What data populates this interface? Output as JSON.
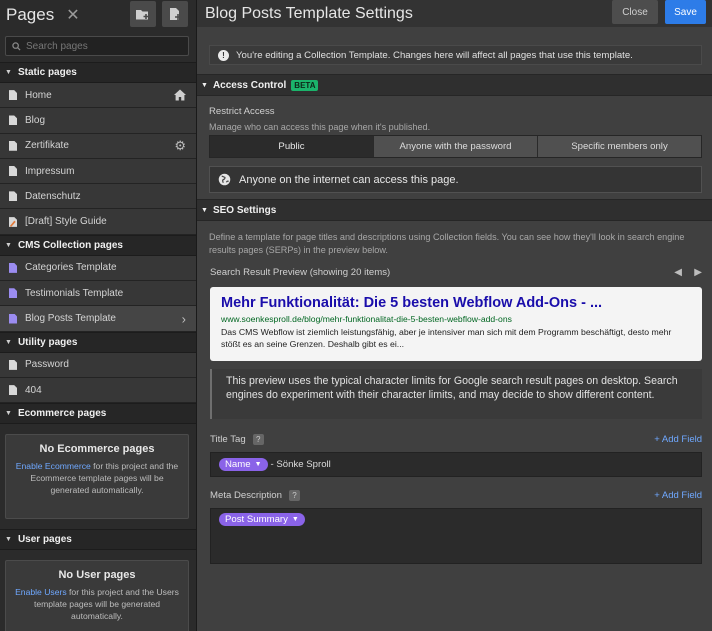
{
  "sidebar": {
    "title": "Pages",
    "search_placeholder": "Search pages",
    "sections": [
      {
        "title": "Static pages",
        "items": [
          {
            "label": "Home",
            "right_icon": "home-icon"
          },
          {
            "label": "Blog"
          },
          {
            "label": "Zertifikate",
            "right_icon": "gear-icon"
          },
          {
            "label": "Impressum"
          },
          {
            "label": "Datenschutz"
          },
          {
            "label": "[Draft] Style Guide"
          }
        ]
      },
      {
        "title": "CMS Collection pages",
        "items": [
          {
            "label": "Categories Template"
          },
          {
            "label": "Testimonials Template"
          },
          {
            "label": "Blog Posts Template",
            "right_icon": "chevron-right-icon"
          }
        ]
      },
      {
        "title": "Utility pages",
        "items": [
          {
            "label": "Password"
          },
          {
            "label": "404"
          }
        ]
      },
      {
        "title": "Ecommerce pages"
      },
      {
        "title": "User pages"
      }
    ],
    "ecommerce_empty": {
      "title": "No Ecommerce pages",
      "link": "Enable Ecommerce",
      "text": "for this project and the Ecommerce template pages will be generated automatically."
    },
    "users_empty": {
      "title": "No User pages",
      "link": "Enable Users",
      "text": "for this project and the Users template pages will be generated automatically."
    }
  },
  "header": {
    "title": "Blog Posts Template Settings",
    "close_label": "Close",
    "save_label": "Save"
  },
  "notice": "You're editing a Collection Template. Changes here will affect all pages that use this template.",
  "access": {
    "title": "Access Control",
    "badge": "BETA",
    "restrict_label": "Restrict Access",
    "restrict_desc": "Manage who can access this page when it's published.",
    "options": [
      "Public",
      "Anyone with the password",
      "Specific members only"
    ],
    "selected": "Public",
    "info": "Anyone on the internet can access this page."
  },
  "seo": {
    "title": "SEO Settings",
    "description": "Define a template for page titles and descriptions using Collection fields. You can see how they'll look in search engine results pages (SERPs) in the preview below.",
    "preview_label": "Search Result Preview (showing 20 items)",
    "serp": {
      "title": "Mehr Funktionalität: Die 5 besten Webflow Add-Ons - ...",
      "url": "www.soenkesproll.de/blog/mehr-funktionalitat-die-5-besten-webflow-add-ons",
      "desc": "Das CMS Webflow ist ziemlich leistungsfähig, aber je intensiver man sich mit dem Programm beschäftigt, desto mehr stößt es an seine Grenzen. Deshalb gibt es ei..."
    },
    "tip": "This preview uses the typical character limits for Google search result pages on desktop. Search engines do experiment with their character limits, and may decide to show different content.",
    "title_tag_label": "Title Tag",
    "title_tag_pill": "Name",
    "title_tag_suffix": "- Sönke Sproll",
    "meta_label": "Meta Description",
    "meta_pill": "Post Summary",
    "add_field": "+ Add Field",
    "help": "?"
  }
}
